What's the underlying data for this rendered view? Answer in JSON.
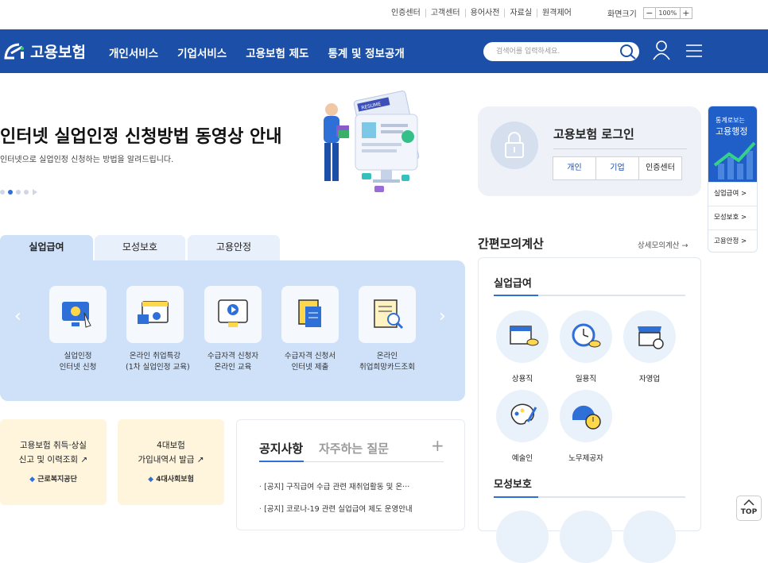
{
  "util": {
    "links": [
      "인증센터",
      "고객센터",
      "용어사전",
      "자료실",
      "원격제어"
    ],
    "zoom_label": "화면크기",
    "zoom_minus": "−",
    "zoom_value": "100%",
    "zoom_plus": "+"
  },
  "gnb": {
    "logo": "고용보험",
    "menu": [
      "개인서비스",
      "기업서비스",
      "고용보험 제도",
      "통계 및 정보공개"
    ],
    "search_placeholder": "검색어를 입력하세요."
  },
  "hero": {
    "title": "인터넷 실업인정 신청방법 동영상 안내",
    "subtitle": "인터넷으로 실업인정 신청하는 방법을 알려드립니다.",
    "resume_label": "RESUME"
  },
  "login": {
    "title": "고용보험 로그인",
    "buttons": [
      "개인",
      "기업",
      "인증센터"
    ]
  },
  "side": {
    "top_small": "통계로보는",
    "top_big": "고용행정",
    "items": [
      "실업급여 >",
      "모성보호 >",
      "고용안정 >"
    ]
  },
  "tabs": [
    "실업급여",
    "모성보호",
    "고용안정"
  ],
  "services": [
    {
      "l1": "실업인정",
      "l2": "인터넷 신청"
    },
    {
      "l1": "온라인 취업특강",
      "l2": "(1차 실업인정 교육)"
    },
    {
      "l1": "수급자격 신청자",
      "l2": "온라인 교육"
    },
    {
      "l1": "수급자격 신청서",
      "l2": "인터넷 제출"
    },
    {
      "l1": "온라인",
      "l2": "취업희망카드조회"
    }
  ],
  "quick": [
    {
      "l1": "고용보험 취득·상실",
      "l2": "신고 및 이력조회",
      "org": "근로복지공단"
    },
    {
      "l1": "4대보험",
      "l2": "가입내역서 발급",
      "org": "4대사회보험"
    }
  ],
  "notice": {
    "tab1": "공지사항",
    "tab2": "자주하는 질문",
    "plus": "+",
    "items": [
      "[공지] 구직급여 수급 관련 재취업활동 및 온···",
      "[공지] 코로나-19 관련 실업급여 제도 운영안내"
    ]
  },
  "calc": {
    "title": "간편모의계산",
    "more": "상세모의계산 →",
    "sec1": "실업급여",
    "sec2": "모성보호",
    "items": [
      "상용직",
      "일용직",
      "자영업",
      "예술인",
      "노무제공자"
    ]
  },
  "top_button": "TOP"
}
